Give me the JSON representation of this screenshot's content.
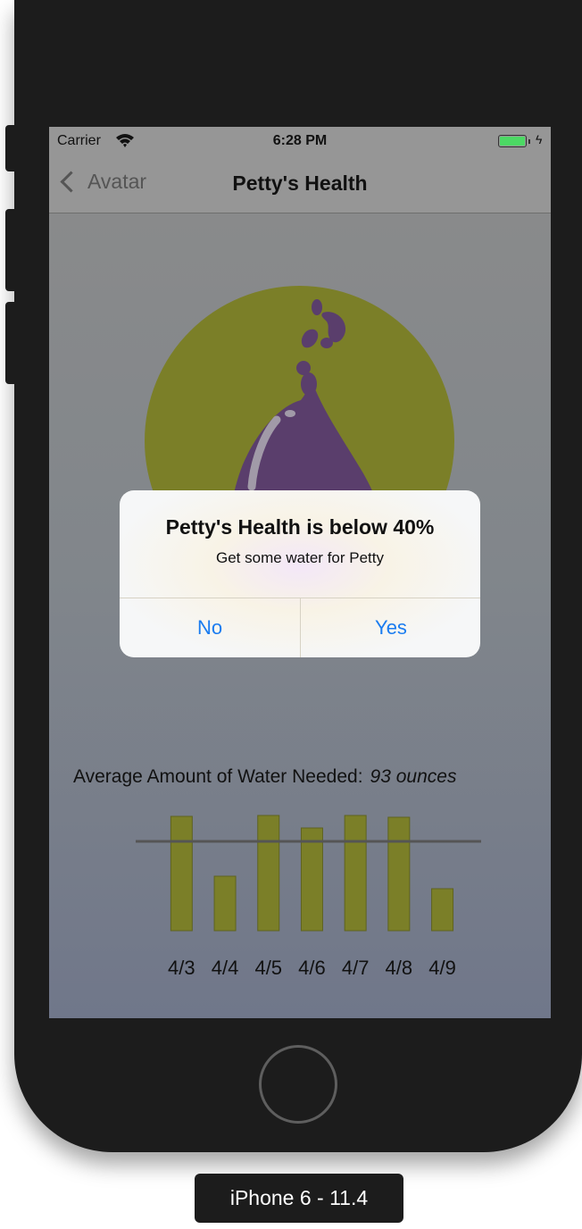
{
  "status_bar": {
    "carrier": "Carrier",
    "time": "6:28 PM",
    "battery_level": 1.0
  },
  "nav": {
    "back_label": "Avatar",
    "title": "Petty's Health"
  },
  "alert": {
    "title": "Petty's Health is below 40%",
    "message": "Get some water for Petty",
    "buttons": [
      "No",
      "Yes"
    ],
    "button_color": "#1a7cf0"
  },
  "water": {
    "label": "Average Amount of Water Needed:",
    "value": "93 ounces"
  },
  "chart_data": {
    "type": "bar",
    "categories": [
      "4/3",
      "4/4",
      "4/5",
      "4/6",
      "4/7",
      "4/8",
      "4/9"
    ],
    "values": [
      128,
      61,
      129,
      115,
      129,
      127,
      47
    ],
    "reference_value": 100,
    "ylim": [
      0,
      130
    ],
    "bar_color": "#7b7f28",
    "reference_line_color": "#555555"
  },
  "avatar": {
    "circle_color": "#7b7f28",
    "drop_color": "#5a3e6c",
    "icon": "water-drop-icon"
  },
  "device": {
    "label": "iPhone 6 - 11.4"
  }
}
